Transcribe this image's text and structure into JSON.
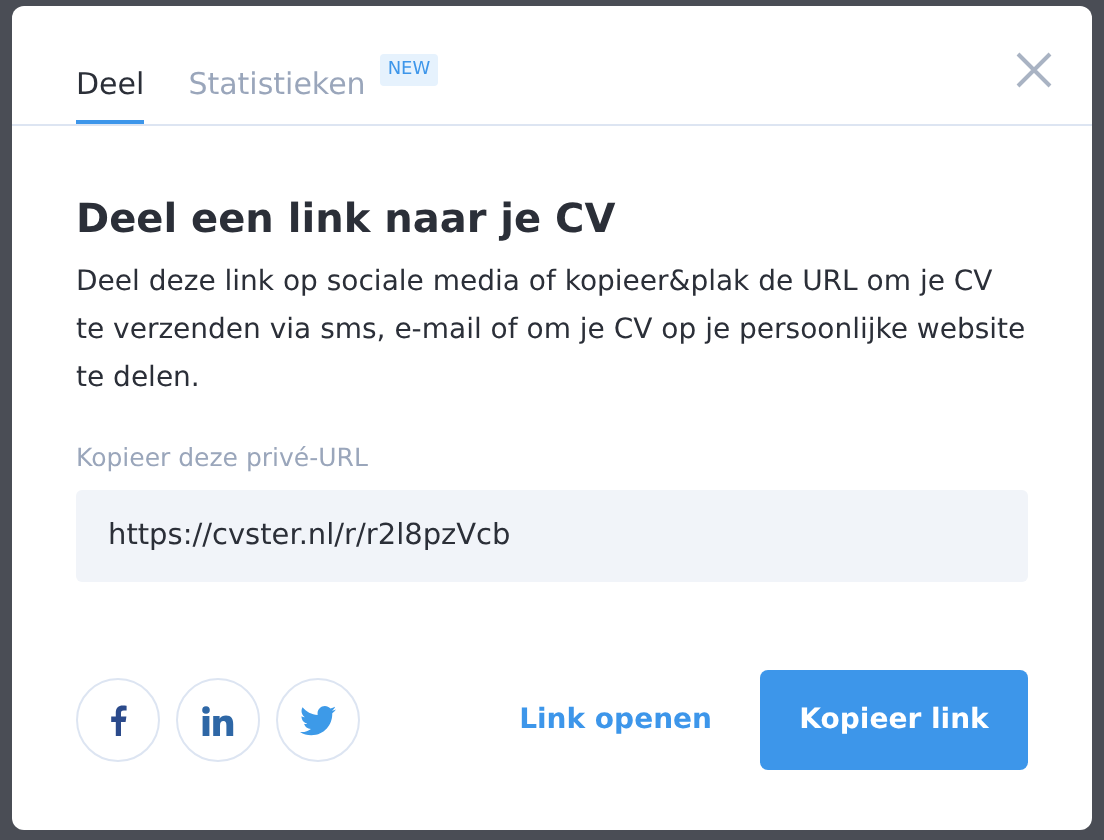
{
  "tabs": [
    {
      "label": "Deel",
      "selected": true
    },
    {
      "label": "Statistieken",
      "selected": false,
      "badge": "NEW"
    }
  ],
  "heading": "Deel een link naar je CV",
  "description": "Deel deze link op sociale media of kopieer&plak de URL om je CV te verzenden via sms, e-mail of om je CV op je persoonlijke website te delen.",
  "url_field": {
    "label": "Kopieer deze privé-URL",
    "value": "https://cvster.nl/r/r2l8pzVcb"
  },
  "social_buttons": [
    {
      "kind": "facebook"
    },
    {
      "kind": "linkedin"
    },
    {
      "kind": "twitter"
    }
  ],
  "open_link": "Link openen",
  "copy_button": "Kopieer link"
}
